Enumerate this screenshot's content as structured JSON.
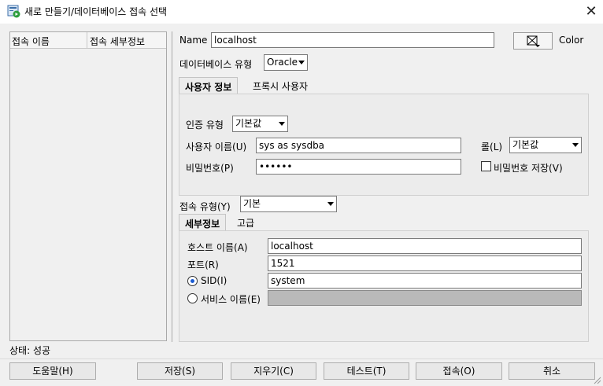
{
  "window": {
    "title": "새로 만들기/데이터베이스 접속 선택",
    "close_glyph": "✕"
  },
  "connection_list": {
    "columns": [
      "접속 이름",
      "접속 세부정보"
    ]
  },
  "form": {
    "name_label": "Name",
    "name_value": "localhost",
    "color_label": "Color",
    "db_type_label": "데이터베이스 유형",
    "db_type_value": "Oracle",
    "tabs": [
      "사용자 정보",
      "프록시 사용자"
    ],
    "auth_type_label": "인증 유형",
    "auth_type_value": "기본값",
    "username_label": "사용자 이름(U)",
    "username_value": "sys as sysdba",
    "role_label": "롤(L)",
    "role_value": "기본값",
    "password_label": "비밀번호(P)",
    "password_value": "••••••",
    "save_password_label": "비밀번호 저장(V)",
    "conn_type_label": "접속 유형(Y)",
    "conn_type_value": "기본",
    "detail_tabs": [
      "세부정보",
      "고급"
    ],
    "host_label": "호스트 이름(A)",
    "host_value": "localhost",
    "port_label": "포트(R)",
    "port_value": "1521",
    "sid_label": "SID(I)",
    "sid_value": "system",
    "service_label": "서비스 이름(E)",
    "service_value": ""
  },
  "status": {
    "text": "상태: 성공"
  },
  "buttons": {
    "help": "도움말(H)",
    "save": "저장(S)",
    "clear": "지우기(C)",
    "test": "테스트(T)",
    "connect": "접속(O)",
    "cancel": "취소"
  },
  "colors": {
    "window_bg": "#f0f0f0",
    "titlebar_bg": "#ffffff",
    "radio_accent": "#1a5bd3",
    "disabled_field": "#b9b9b9"
  }
}
